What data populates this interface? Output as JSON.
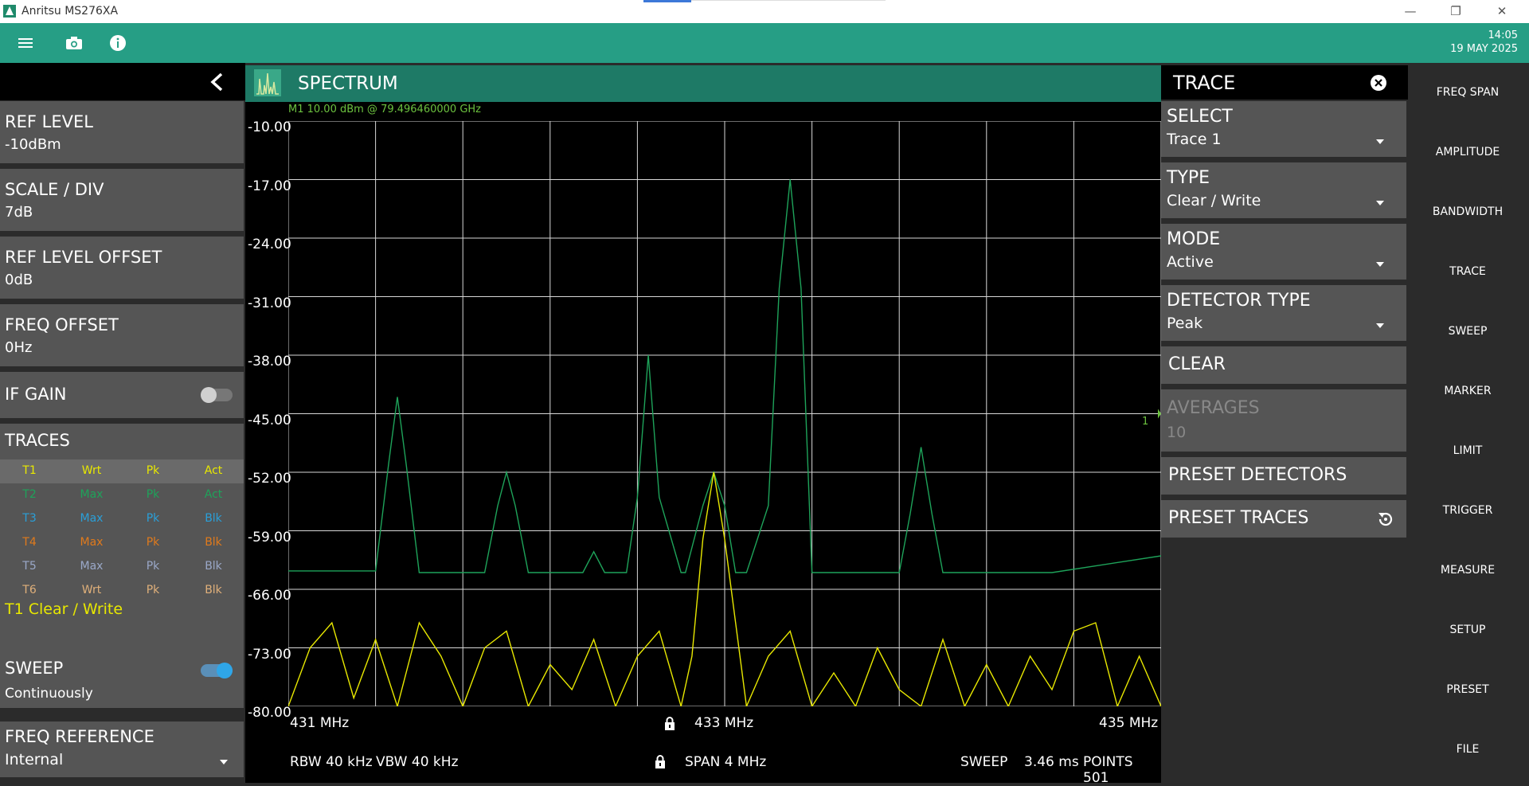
{
  "window": {
    "title": "Anritsu MS276XA",
    "minimize": "—",
    "restore": "❐",
    "close": "✕"
  },
  "toolbar": {
    "time": "14:05",
    "date": "19 MAY 2025"
  },
  "left_panel": {
    "items": [
      {
        "label": "REF LEVEL",
        "value": "-10dBm"
      },
      {
        "label": "SCALE / DIV",
        "value": "7dB"
      },
      {
        "label": "REF LEVEL OFFSET",
        "value": "0dB"
      },
      {
        "label": "FREQ OFFSET",
        "value": "0Hz"
      }
    ],
    "if_gain": {
      "label": "IF GAIN",
      "on": false
    },
    "traces": {
      "label": "TRACES",
      "rows": [
        {
          "name": "T1",
          "type": "Wrt",
          "det": "Pk",
          "mode": "Act",
          "color": "#e8e800"
        },
        {
          "name": "T2",
          "type": "Max",
          "det": "Pk",
          "mode": "Act",
          "color": "#1ea35a"
        },
        {
          "name": "T3",
          "type": "Max",
          "det": "Pk",
          "mode": "Blk",
          "color": "#2a9fd8"
        },
        {
          "name": "T4",
          "type": "Max",
          "det": "Pk",
          "mode": "Blk",
          "color": "#e07a1c"
        },
        {
          "name": "T5",
          "type": "Max",
          "det": "Pk",
          "mode": "Blk",
          "color": "#9aa8c8"
        },
        {
          "name": "T6",
          "type": "Wrt",
          "det": "Pk",
          "mode": "Blk",
          "color": "#e0b07a"
        }
      ],
      "selected": "T1 Clear / Write"
    },
    "sweep": {
      "label": "SWEEP",
      "value": "Continuously",
      "on": true
    },
    "freq_reference": {
      "label": "FREQ REFERENCE",
      "value": "Internal"
    }
  },
  "spectrum": {
    "title": "SPECTRUM",
    "marker_readout": "M1    10.00  dBm  @  79.496460000 GHz",
    "marker_tag": "1",
    "y_labels": [
      "-10.00",
      "-17.00",
      "-24.00",
      "-31.00",
      "-38.00",
      "-45.00",
      "-52.00",
      "-59.00",
      "-66.00",
      "-73.00",
      "-80.00"
    ],
    "x_start": "431 MHz",
    "x_center": "433 MHz",
    "x_stop": "435 MHz",
    "rbw": "RBW 40 kHz",
    "vbw": "VBW 40 kHz",
    "span": "SPAN 4 MHz",
    "sweep_label": "SWEEP",
    "sweep_time": "3.46 ms",
    "points": "POINTS 501",
    "colors": {
      "trace1": "#e8e800",
      "trace2": "#1ea35a",
      "grid": "#d8d8d8"
    }
  },
  "chart_data": {
    "type": "line",
    "xlim": [
      431,
      435
    ],
    "ylim": [
      -80,
      -10
    ],
    "xlabel": "",
    "ylabel": "",
    "grid": true,
    "series": [
      {
        "x": [
          431.0,
          431.4,
          431.46,
          431.5,
          431.54,
          431.6,
          431.9,
          431.96,
          432.0,
          432.04,
          432.1,
          432.35,
          432.4,
          432.45,
          432.55,
          432.6,
          432.65,
          432.7,
          432.8,
          432.82,
          432.9,
          432.95,
          433.0,
          433.05,
          433.1,
          433.2,
          433.25,
          433.3,
          433.35,
          433.4,
          433.8,
          433.85,
          433.9,
          433.95,
          434.0,
          434.5,
          435.0
        ],
        "values": [
          -63.8,
          -63.8,
          -51.0,
          -43.0,
          -51.0,
          -64.0,
          -64.0,
          -56.0,
          -52.0,
          -56.0,
          -64.0,
          -64.0,
          -61.5,
          -64.0,
          -64.0,
          -55.0,
          -38.0,
          -55.0,
          -64.0,
          -64.0,
          -56.0,
          -52.0,
          -56.0,
          -64.0,
          -64.0,
          -56.0,
          -30.0,
          -17.0,
          -30.0,
          -64.0,
          -64.0,
          -57.0,
          -49.0,
          -57.0,
          -64.0,
          -64.0,
          -62.0
        ]
      },
      {
        "x": [
          431.0,
          431.1,
          431.2,
          431.3,
          431.4,
          431.5,
          431.6,
          431.7,
          431.8,
          431.9,
          432.0,
          432.1,
          432.2,
          432.3,
          432.4,
          432.5,
          432.6,
          432.7,
          432.8,
          432.85,
          432.9,
          432.95,
          433.0,
          433.1,
          433.2,
          433.3,
          433.4,
          433.5,
          433.6,
          433.7,
          433.8,
          433.9,
          434.0,
          434.1,
          434.2,
          434.3,
          434.4,
          434.5,
          434.6,
          434.7,
          434.8,
          434.9,
          435.0
        ],
        "values": [
          -80,
          -73,
          -70,
          -79,
          -72,
          -80,
          -70,
          -74,
          -80,
          -73,
          -71,
          -80,
          -75,
          -78,
          -72,
          -80,
          -74,
          -71,
          -80,
          -74,
          -60,
          -52,
          -60,
          -80,
          -74,
          -71,
          -80,
          -76,
          -80,
          -73,
          -78,
          -80,
          -72,
          -80,
          -75,
          -80,
          -74,
          -78,
          -71,
          -70,
          -80,
          -74,
          -80
        ]
      }
    ]
  },
  "right_panel": {
    "title": "TRACE",
    "items": [
      {
        "label": "SELECT",
        "value": "Trace 1"
      },
      {
        "label": "TYPE",
        "value": "Clear / Write"
      },
      {
        "label": "MODE",
        "value": "Active"
      },
      {
        "label": "DETECTOR TYPE",
        "value": "Peak"
      }
    ],
    "clear": "CLEAR",
    "averages": {
      "label": "AVERAGES",
      "value": "10"
    },
    "preset_detectors": "PRESET DETECTORS",
    "preset_traces": "PRESET TRACES"
  },
  "menu": [
    "FREQ SPAN",
    "AMPLITUDE",
    "BANDWIDTH",
    "TRACE",
    "SWEEP",
    "MARKER",
    "LIMIT",
    "TRIGGER",
    "MEASURE",
    "SETUP",
    "PRESET",
    "FILE"
  ]
}
